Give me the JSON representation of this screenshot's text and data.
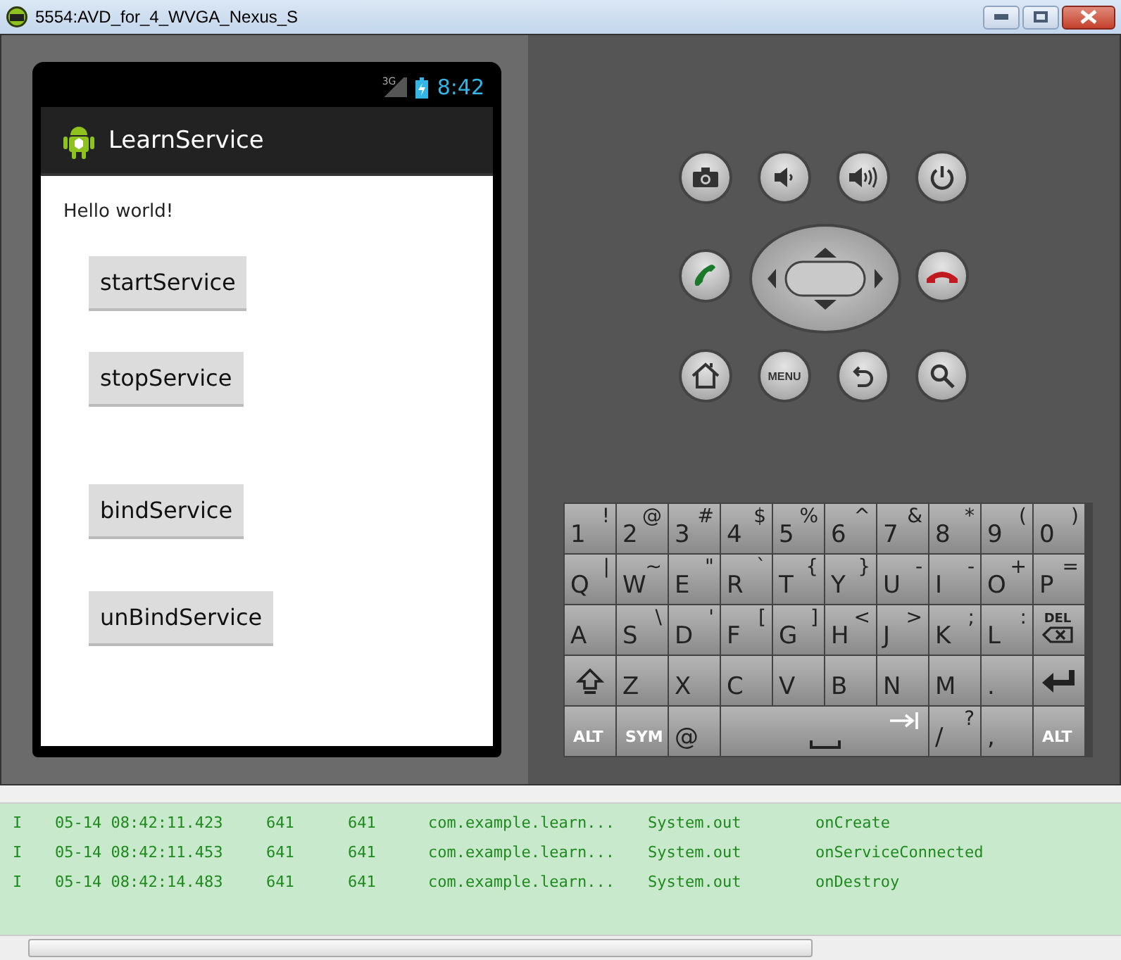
{
  "window": {
    "title": "5554:AVD_for_4_WVGA_Nexus_S"
  },
  "phone": {
    "network": "3G",
    "time": "8:42",
    "app_title": "LearnService",
    "greeting": "Hello world!",
    "buttons": [
      "startService",
      "stopService",
      "bindService",
      "unBindService"
    ]
  },
  "hardware_buttons": [
    {
      "kind": "camera"
    },
    {
      "kind": "volume-down"
    },
    {
      "kind": "volume-up"
    },
    {
      "kind": "power"
    },
    {
      "kind": "call"
    },
    {
      "kind": "dpad"
    },
    {
      "kind": "end-call"
    },
    {
      "kind": "home"
    },
    {
      "kind": "menu",
      "label": "MENU"
    },
    {
      "kind": "back"
    },
    {
      "kind": "search"
    }
  ],
  "keyboard": {
    "key_rows": [
      {
        "keys": [
          {
            "main": "1",
            "alt": "!"
          },
          {
            "main": "2",
            "alt": "@"
          },
          {
            "main": "3",
            "alt": "#"
          },
          {
            "main": "4",
            "alt": "$"
          },
          {
            "main": "5",
            "alt": "%"
          },
          {
            "main": "6",
            "alt": "^"
          },
          {
            "main": "7",
            "alt": "&"
          },
          {
            "main": "8",
            "alt": "*"
          },
          {
            "main": "9",
            "alt": "("
          },
          {
            "main": "0",
            "alt": ")"
          }
        ]
      },
      {
        "keys": [
          {
            "main": "Q",
            "alt": "|"
          },
          {
            "main": "W",
            "alt": "~"
          },
          {
            "main": "E",
            "alt": "\""
          },
          {
            "main": "R",
            "alt": "`"
          },
          {
            "main": "T",
            "alt": "{"
          },
          {
            "main": "Y",
            "alt": "}"
          },
          {
            "main": "U",
            "alt": "-"
          },
          {
            "main": "I",
            "alt": "-"
          },
          {
            "main": "O",
            "alt": "+"
          },
          {
            "main": "P",
            "alt": "="
          }
        ]
      },
      {
        "keys": [
          {
            "main": "A"
          },
          {
            "main": "S",
            "alt": "\\"
          },
          {
            "main": "D",
            "alt": "'"
          },
          {
            "main": "F",
            "alt": "["
          },
          {
            "main": "G",
            "alt": "]"
          },
          {
            "main": "H",
            "alt": "<"
          },
          {
            "main": "J",
            "alt": ">"
          },
          {
            "main": "K",
            "alt": ";"
          },
          {
            "main": "L",
            "alt": ":"
          },
          {
            "kind": "del",
            "main": "DEL"
          }
        ]
      },
      {
        "keys": [
          {
            "kind": "shift"
          },
          {
            "main": "Z"
          },
          {
            "main": "X"
          },
          {
            "main": "C"
          },
          {
            "main": "V"
          },
          {
            "main": "B"
          },
          {
            "main": "N"
          },
          {
            "main": "M"
          },
          {
            "main": "."
          },
          {
            "kind": "enter"
          }
        ]
      },
      {
        "keys": [
          {
            "kind": "small",
            "main": "ALT"
          },
          {
            "kind": "small",
            "main": "SYM"
          },
          {
            "main": "@"
          },
          {
            "kind": "space"
          },
          {
            "main": "/",
            "alt": "?"
          },
          {
            "main": ","
          },
          {
            "kind": "small",
            "main": "ALT"
          }
        ]
      }
    ]
  },
  "log": {
    "rows": [
      {
        "level": "I",
        "time": "05-14 08:42:11.423",
        "pid": "641",
        "tid": "641",
        "application": "com.example.learn...",
        "tag": "System.out",
        "text": "onCreate"
      },
      {
        "level": "I",
        "time": "05-14 08:42:11.453",
        "pid": "641",
        "tid": "641",
        "application": "com.example.learn...",
        "tag": "System.out",
        "text": "onServiceConnected"
      },
      {
        "level": "I",
        "time": "05-14 08:42:14.483",
        "pid": "641",
        "tid": "641",
        "application": "com.example.learn...",
        "tag": "System.out",
        "text": "onDestroy"
      }
    ]
  }
}
